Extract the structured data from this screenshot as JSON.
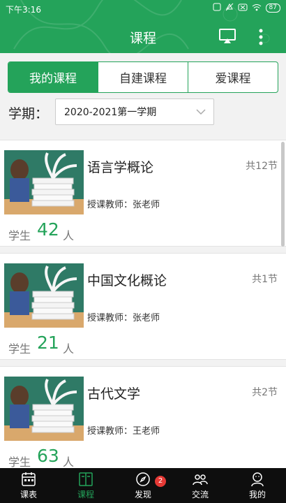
{
  "status_bar": {
    "time": "下午3:16",
    "battery": "87"
  },
  "header": {
    "title": "课程"
  },
  "tabs": [
    {
      "label": "我的课程",
      "active": true
    },
    {
      "label": "自建课程",
      "active": false
    },
    {
      "label": "爱课程",
      "active": false
    }
  ],
  "term": {
    "label": "学期：",
    "selected": "2020-2021第一学期"
  },
  "courses": [
    {
      "title": "语言学概论",
      "lessons": "共12节",
      "teacher": "授课教师：张老师",
      "student_label": "学生",
      "student_count": "42",
      "student_unit": "人"
    },
    {
      "title": "中国文化概论",
      "lessons": "共1节",
      "teacher": "授课教师：张老师",
      "student_label": "学生",
      "student_count": "21",
      "student_unit": "人"
    },
    {
      "title": "古代文学",
      "lessons": "共2节",
      "teacher": "授课教师：王老师",
      "student_label": "学生",
      "student_count": "63",
      "student_unit": "人"
    }
  ],
  "bottom_nav": [
    {
      "label": "课表",
      "icon": "calendar-icon",
      "active": false
    },
    {
      "label": "课程",
      "icon": "book-icon",
      "active": true
    },
    {
      "label": "发现",
      "icon": "compass-icon",
      "active": false,
      "badge": "2"
    },
    {
      "label": "交流",
      "icon": "chat-icon",
      "active": false
    },
    {
      "label": "我的",
      "icon": "profile-icon",
      "active": false
    }
  ],
  "colors": {
    "accent": "#24a35a",
    "nav_bg": "#0e0e0e",
    "badge": "#e53935"
  }
}
